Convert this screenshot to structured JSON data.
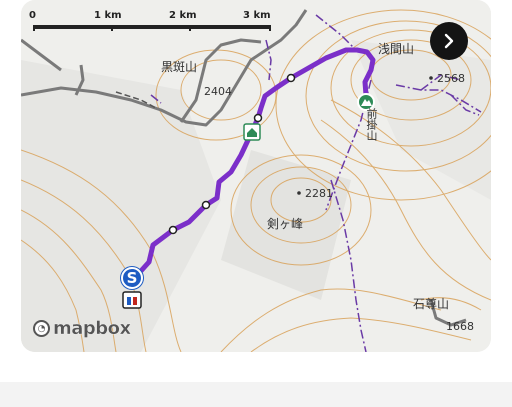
{
  "map": {
    "scale": {
      "labels": [
        "0",
        "1 km",
        "2 km",
        "3 km"
      ]
    },
    "elevations": [
      "2404",
      "2568",
      "2281",
      "1668"
    ],
    "places": {
      "kurofu": "黒斑山",
      "asama": "浅間山",
      "asama_short": "前掛山",
      "tsurugi": "剣ヶ峰",
      "ishizon": "石尊山"
    },
    "start_marker": "S",
    "attribution": "mapbox"
  },
  "colors": {
    "route": "#7b2fc9",
    "start": "#1e5cc2",
    "trail": "#6a3aa6",
    "contour": "#d9a25a"
  },
  "icons": {
    "next": "chevron-right-icon",
    "hut": "hut-icon",
    "peak": "peak-icon",
    "toilet": "toilet-icon"
  }
}
